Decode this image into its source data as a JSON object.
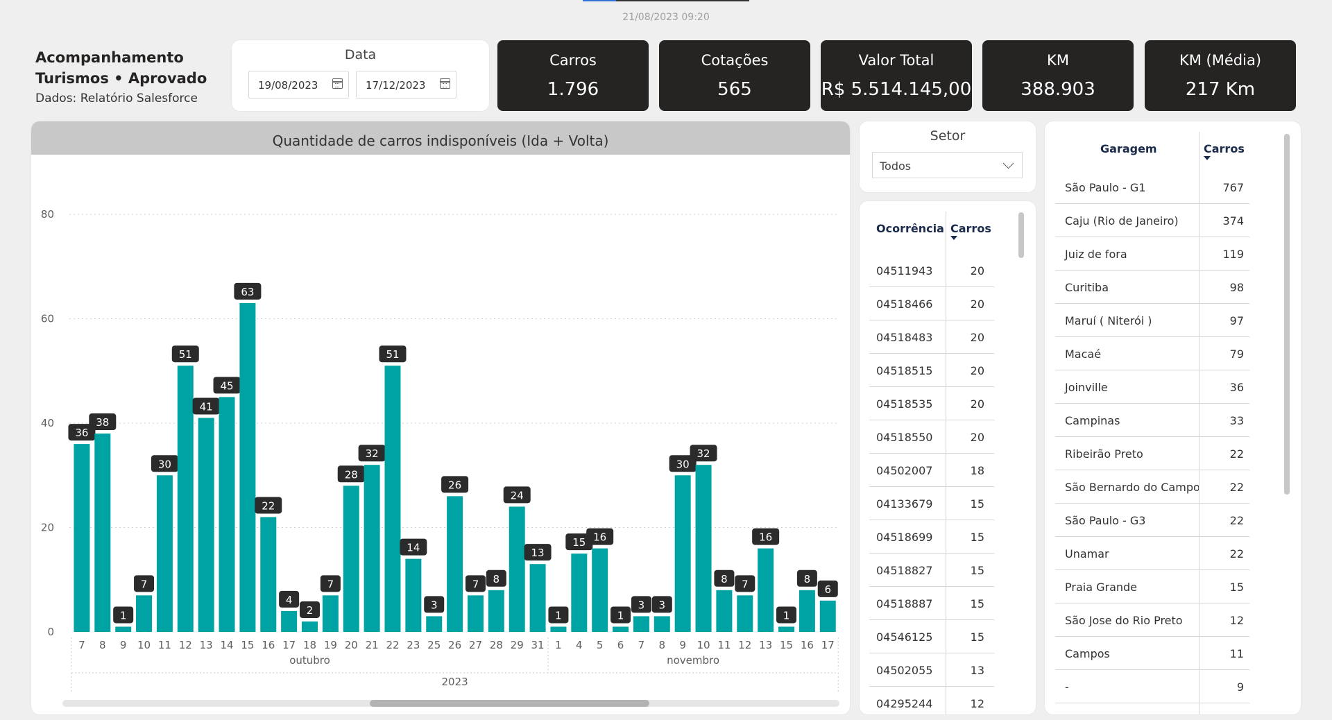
{
  "header": {
    "timestamp": "21/08/2023 09:20"
  },
  "title": {
    "line1": "Acompanhamento",
    "line2": "Turismos • Aprovado",
    "subtitle": "Dados: Relatório Salesforce"
  },
  "date_filter": {
    "label": "Data",
    "start": "19/08/2023",
    "end": "17/12/2023"
  },
  "kpis": [
    {
      "label": "Carros",
      "value": "1.796"
    },
    {
      "label": "Cotações",
      "value": "565"
    },
    {
      "label": "Valor Total",
      "value": "R$ 5.514.145,00"
    },
    {
      "label": "KM",
      "value": "388.903"
    },
    {
      "label": "KM (Média)",
      "value": "217 Km"
    }
  ],
  "setor": {
    "label": "Setor",
    "value": "Todos"
  },
  "occurrences": {
    "col1": "Ocorrência",
    "col2": "Carros",
    "rows": [
      [
        "04511943",
        "20"
      ],
      [
        "04518466",
        "20"
      ],
      [
        "04518483",
        "20"
      ],
      [
        "04518515",
        "20"
      ],
      [
        "04518535",
        "20"
      ],
      [
        "04518550",
        "20"
      ],
      [
        "04502007",
        "18"
      ],
      [
        "04133679",
        "15"
      ],
      [
        "04518699",
        "15"
      ],
      [
        "04518827",
        "15"
      ],
      [
        "04518887",
        "15"
      ],
      [
        "04546125",
        "15"
      ],
      [
        "04502055",
        "13"
      ],
      [
        "04295244",
        "12"
      ]
    ]
  },
  "garages": {
    "col1": "Garagem",
    "col2": "Carros",
    "rows": [
      [
        "São Paulo - G1",
        "767"
      ],
      [
        "Caju (Rio de Janeiro)",
        "374"
      ],
      [
        "Juiz de fora",
        "119"
      ],
      [
        "Curitiba",
        "98"
      ],
      [
        "Maruí ( Niterói )",
        "97"
      ],
      [
        "Macaé",
        "79"
      ],
      [
        "Joinville",
        "36"
      ],
      [
        "Campinas",
        "33"
      ],
      [
        "Ribeirão Preto",
        "22"
      ],
      [
        "São Bernardo do Campo",
        "22"
      ],
      [
        "São Paulo - G3",
        "22"
      ],
      [
        "Unamar",
        "22"
      ],
      [
        "Praia Grande",
        "15"
      ],
      [
        "São Jose do Rio Preto",
        "12"
      ],
      [
        "Campos",
        "11"
      ],
      [
        "-",
        "9"
      ]
    ]
  },
  "chart_data": {
    "type": "bar",
    "title": "Quantidade de carros indisponíveis (Ida + Volta)",
    "categories": [
      "7",
      "8",
      "9",
      "10",
      "11",
      "12",
      "13",
      "14",
      "15",
      "16",
      "17",
      "18",
      "19",
      "20",
      "21",
      "22",
      "23",
      "25",
      "26",
      "27",
      "28",
      "29",
      "31",
      "1",
      "4",
      "5",
      "6",
      "7",
      "8",
      "9",
      "10",
      "11",
      "12",
      "13",
      "15",
      "16",
      "17"
    ],
    "values": [
      36,
      38,
      1,
      7,
      30,
      51,
      41,
      45,
      63,
      22,
      4,
      2,
      7,
      28,
      32,
      51,
      14,
      3,
      26,
      7,
      8,
      24,
      13,
      1,
      15,
      16,
      1,
      3,
      3,
      30,
      32,
      8,
      7,
      16,
      1,
      8,
      6
    ],
    "months": [
      {
        "label": "outubro",
        "start": 0,
        "end": 22
      },
      {
        "label": "novembro",
        "start": 23,
        "end": 36
      }
    ],
    "year": "2023",
    "yticks": [
      0,
      20,
      40,
      60,
      80
    ],
    "ylim": [
      0,
      80
    ],
    "bar_color": "#00a3a3",
    "label_bg": "#2b2b2b"
  }
}
